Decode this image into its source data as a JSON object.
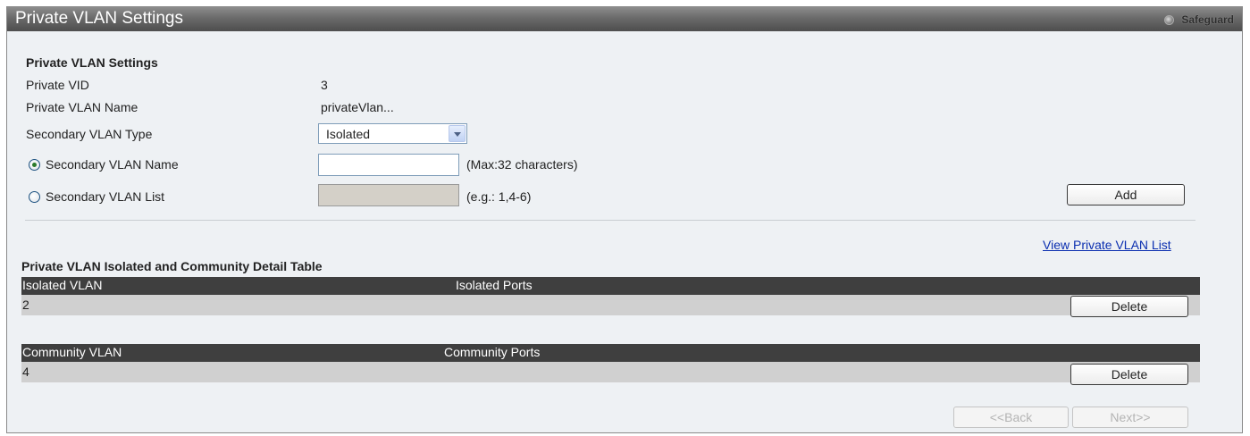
{
  "header": {
    "title": "Private VLAN Settings",
    "safeguard_label": "Safeguard"
  },
  "settings": {
    "section_title": "Private VLAN Settings",
    "private_vid_label": "Private VID",
    "private_vid_value": "3",
    "private_vlan_name_label": "Private VLAN Name",
    "private_vlan_name_value": "privateVlan...",
    "secondary_type_label": "Secondary VLAN Type",
    "secondary_type_value": "Isolated",
    "secondary_name_label": "Secondary VLAN Name",
    "secondary_name_value": "",
    "secondary_name_hint": "(Max:32 characters)",
    "secondary_list_label": "Secondary VLAN List",
    "secondary_list_value": "",
    "secondary_list_hint": "(e.g.: 1,4-6)",
    "selected_option": "Secondary VLAN Name",
    "add_button": "Add"
  },
  "view_link": "View Private VLAN List",
  "detail": {
    "table_title": "Private VLAN Isolated and Community Detail Table",
    "isolated": {
      "columns": [
        "Isolated VLAN",
        "Isolated Ports"
      ],
      "rows": [
        {
          "vlan": "2",
          "ports": ""
        }
      ],
      "delete_label": "Delete"
    },
    "community": {
      "columns": [
        "Community VLAN",
        "Community Ports"
      ],
      "rows": [
        {
          "vlan": "4",
          "ports": ""
        }
      ],
      "delete_label": "Delete"
    }
  },
  "pager": {
    "back_label": "<<Back",
    "next_label": "Next>>"
  },
  "colors": {
    "table_header_bg": "#3f3f3f",
    "row_bg": "#d0d0d0",
    "panel_bg": "#eef1f4",
    "link": "#0b2fb0"
  }
}
